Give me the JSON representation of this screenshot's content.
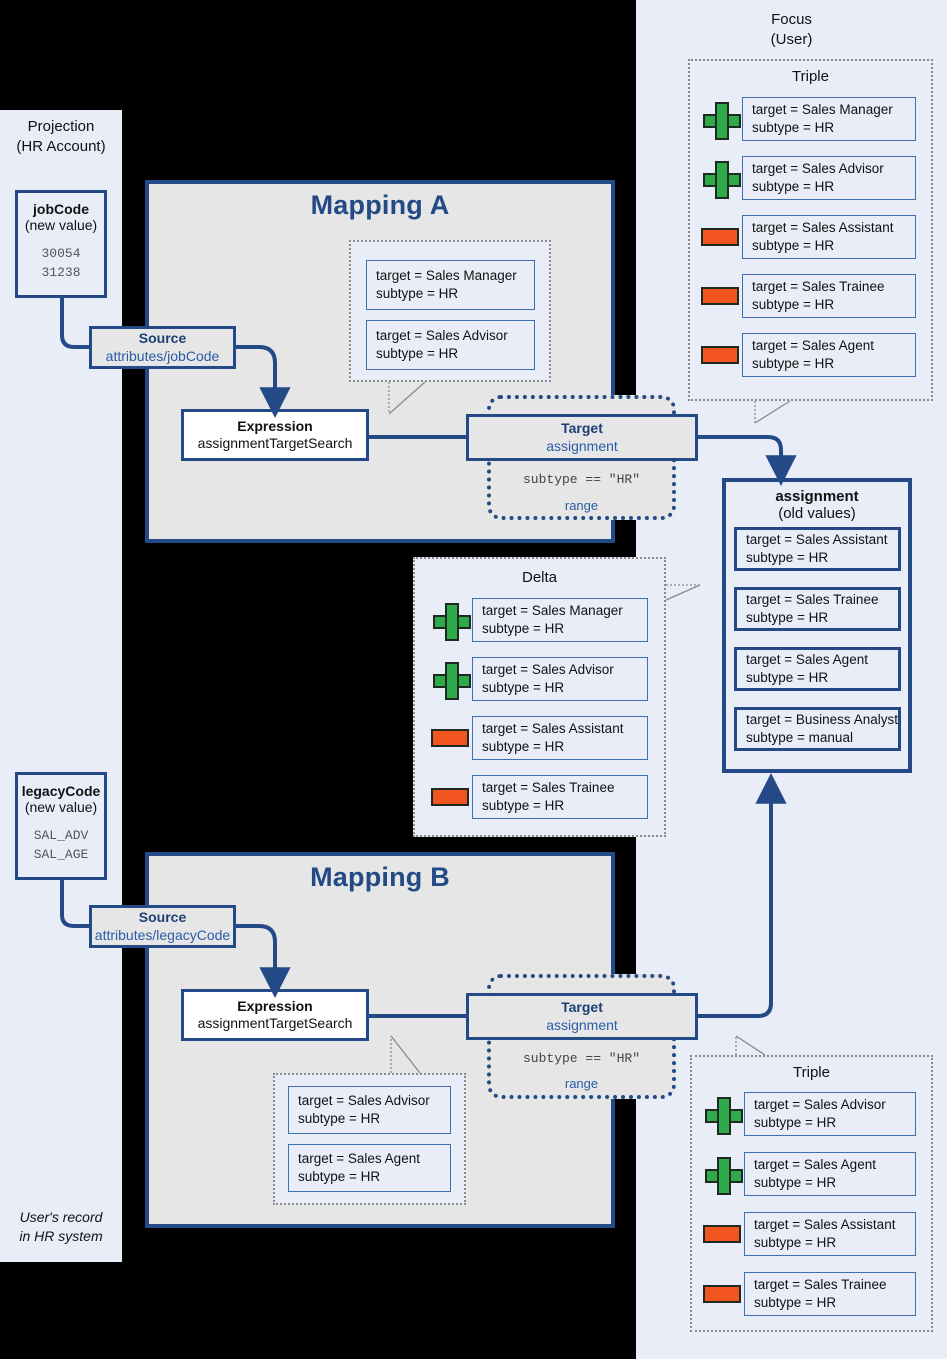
{
  "projection": {
    "title_line1": "Projection",
    "title_line2": "(HR Account)",
    "footer_line1": "User's record",
    "footer_line2": "in HR system",
    "jobcode": {
      "name": "jobCode",
      "qualifier": "(new value)",
      "values": "30054\n31238"
    },
    "legacycode": {
      "name": "legacyCode",
      "qualifier": "(new value)",
      "values": "SAL_ADV\nSAL_AGE"
    }
  },
  "focus": {
    "title_line1": "Focus",
    "title_line2": "(User)",
    "triple_top": {
      "title": "Triple",
      "items": [
        {
          "sign": "plus",
          "target": "target = Sales Manager",
          "subtype": "subtype = HR"
        },
        {
          "sign": "plus",
          "target": "target = Sales Advisor",
          "subtype": "subtype = HR"
        },
        {
          "sign": "minus",
          "target": "target = Sales Assistant",
          "subtype": "subtype = HR"
        },
        {
          "sign": "minus",
          "target": "target = Sales Trainee",
          "subtype": "subtype = HR"
        },
        {
          "sign": "minus",
          "target": "target = Sales Agent",
          "subtype": "subtype = HR"
        }
      ]
    },
    "assignment": {
      "title": "assignment",
      "qualifier": "(old values)",
      "items": [
        {
          "target": "target = Sales Assistant",
          "subtype": "subtype = HR"
        },
        {
          "target": "target = Sales Trainee",
          "subtype": "subtype = HR"
        },
        {
          "target": "target = Sales Agent",
          "subtype": "subtype = HR"
        },
        {
          "target": "target = Business Analyst",
          "subtype": "subtype = manual"
        }
      ]
    },
    "triple_bottom": {
      "title": "Triple",
      "items": [
        {
          "sign": "plus",
          "target": "target = Sales Advisor",
          "subtype": "subtype = HR"
        },
        {
          "sign": "plus",
          "target": "target = Sales Agent",
          "subtype": "subtype = HR"
        },
        {
          "sign": "minus",
          "target": "target = Sales Assistant",
          "subtype": "subtype = HR"
        },
        {
          "sign": "minus",
          "target": "target = Sales Trainee",
          "subtype": "subtype = HR"
        }
      ]
    }
  },
  "delta": {
    "title": "Delta",
    "items": [
      {
        "sign": "plus",
        "target": "target = Sales Manager",
        "subtype": "subtype = HR"
      },
      {
        "sign": "plus",
        "target": "target = Sales Advisor",
        "subtype": "subtype = HR"
      },
      {
        "sign": "minus",
        "target": "target = Sales Assistant",
        "subtype": "subtype = HR"
      },
      {
        "sign": "minus",
        "target": "target = Sales Trainee",
        "subtype": "subtype = HR"
      }
    ]
  },
  "mapping_a": {
    "title": "Mapping A",
    "source": {
      "title": "Source",
      "subtitle": "attributes/jobCode"
    },
    "expression": {
      "title": "Expression",
      "subtitle": "assignmentTargetSearch"
    },
    "target": {
      "title": "Target",
      "subtitle": "assignment",
      "condition": "subtype == \"HR\"",
      "range_label": "range"
    },
    "callout_items": [
      {
        "target": "target = Sales Manager",
        "subtype": "subtype = HR"
      },
      {
        "target": "target = Sales Advisor",
        "subtype": "subtype = HR"
      }
    ]
  },
  "mapping_b": {
    "title": "Mapping B",
    "source": {
      "title": "Source",
      "subtitle": "attributes/legacyCode"
    },
    "expression": {
      "title": "Expression",
      "subtitle": "assignmentTargetSearch"
    },
    "target": {
      "title": "Target",
      "subtitle": "assignment",
      "condition": "subtype == \"HR\"",
      "range_label": "range"
    },
    "callout_items": [
      {
        "target": "target = Sales Advisor",
        "subtype": "subtype = HR"
      },
      {
        "target": "target = Sales Agent",
        "subtype": "subtype = HR"
      }
    ]
  },
  "colors": {
    "background": "#000000",
    "panel": "#e8edf8",
    "mapping_fill": "#e6e6e6",
    "accent_blue": "#234a86",
    "link_blue": "#2a5ca8",
    "plus_green": "#2faa4b",
    "minus_orange": "#f2551f"
  }
}
